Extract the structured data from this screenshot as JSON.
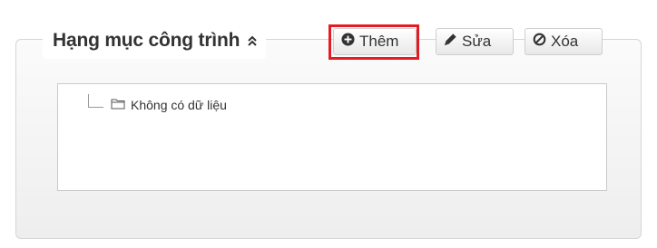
{
  "panel": {
    "title": "Hạng mục công trình",
    "collapse_icon": "double-chevron-up-icon"
  },
  "toolbar": {
    "add_label": "Thêm",
    "add_icon": "plus-circle-icon",
    "edit_label": "Sửa",
    "edit_icon": "pencil-icon",
    "delete_label": "Xóa",
    "delete_icon": "ban-icon",
    "highlight_color": "#e31b23"
  },
  "tree": {
    "empty_label": "Không có dữ liệu",
    "empty_icon": "folder-icon"
  }
}
